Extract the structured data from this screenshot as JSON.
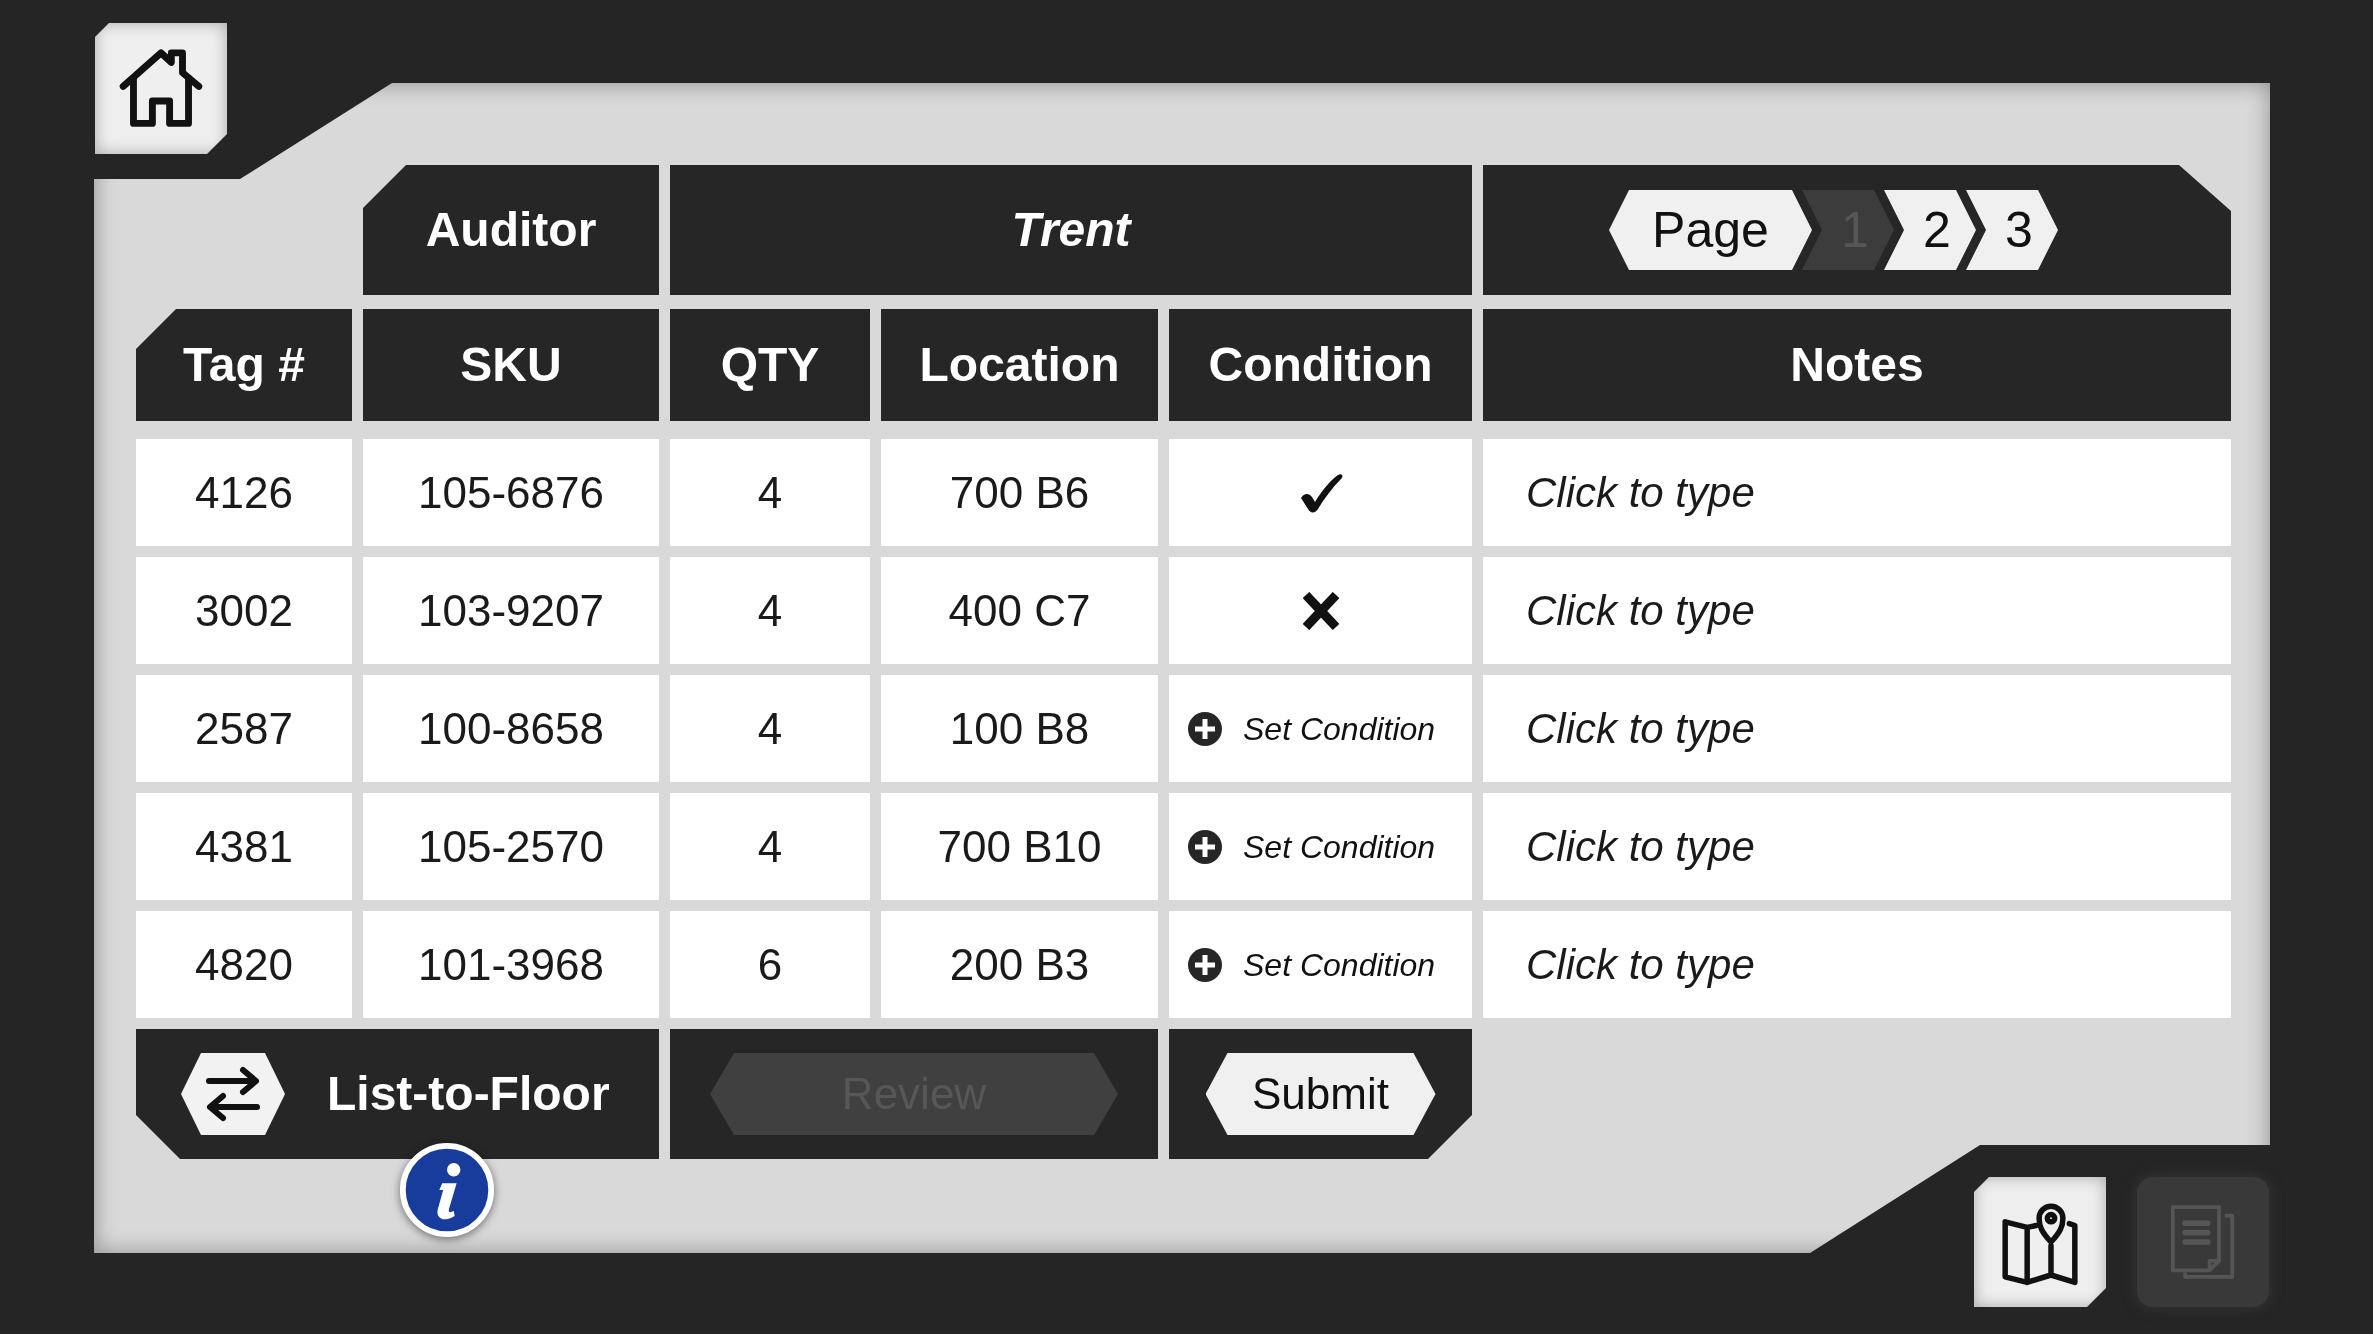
{
  "shortcut_buttons": [
    {
      "kind": "map",
      "disabled": false
    },
    {
      "kind": "document",
      "disabled": true
    }
  ],
  "header": {
    "auditor_label": "Auditor",
    "auditor_name": "Trent"
  },
  "pagination": {
    "label": "Page",
    "pages": [
      {
        "label": "1",
        "selected": true
      },
      {
        "label": "2",
        "selected": false
      },
      {
        "label": "3",
        "selected": false
      }
    ]
  },
  "table": {
    "columns": [
      "Tag #",
      "SKU",
      "QTY",
      "Location",
      "Condition",
      "Notes"
    ],
    "rows": [
      {
        "tag": "4126",
        "sku": "105-6876",
        "qty": "4",
        "location": "700 B6",
        "condition": {
          "kind": "check"
        },
        "notes": {
          "placeholder": "Click to type"
        }
      },
      {
        "tag": "3002",
        "sku": "103-9207",
        "qty": "4",
        "location": "400 C7",
        "condition": {
          "kind": "cross"
        },
        "notes": {
          "placeholder": "Click to type"
        }
      },
      {
        "tag": "2587",
        "sku": "100-8658",
        "qty": "4",
        "location": "100 B8",
        "condition": {
          "kind": "unset",
          "label": "Set Condition"
        },
        "notes": {
          "placeholder": "Click to type"
        }
      },
      {
        "tag": "4381",
        "sku": "105-2570",
        "qty": "4",
        "location": "700 B10",
        "condition": {
          "kind": "unset",
          "label": "Set Condition"
        },
        "notes": {
          "placeholder": "Click to type"
        }
      },
      {
        "tag": "4820",
        "sku": "101-3968",
        "qty": "6",
        "location": "200 B3",
        "condition": {
          "kind": "unset",
          "label": "Set Condition"
        },
        "notes": {
          "placeholder": "Click to type"
        }
      }
    ]
  },
  "actions": {
    "mode_button": {
      "label": "List-to-Floor"
    },
    "review_button": {
      "label": "Review",
      "disabled": true
    },
    "submit_button": {
      "label": "Submit",
      "disabled": false
    }
  }
}
